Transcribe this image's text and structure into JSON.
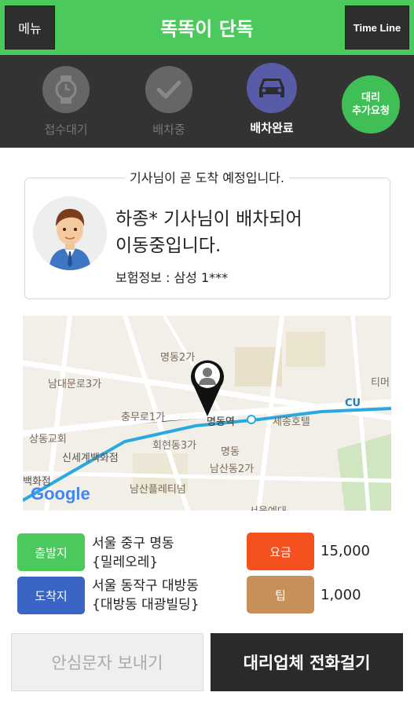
{
  "header": {
    "menu_label": "메뉴",
    "title": "똑똑이 단독",
    "timeline_label": "Time Line"
  },
  "status_steps": [
    {
      "label": "접수대기",
      "icon": "watch-icon"
    },
    {
      "label": "배차중",
      "icon": "check-icon"
    },
    {
      "label": "배차완료",
      "icon": "car-icon"
    }
  ],
  "extra_request": {
    "line1": "대리",
    "line2": "추가요청"
  },
  "notice": "기사님이 곧 도착 예정입니다.",
  "driver": {
    "line1": "하종* 기사님이 배차되어",
    "line2": "이동중입니다.",
    "insurance": "보험정보 : 삼성 1***"
  },
  "map": {
    "labels": [
      "명동2가",
      "남대문로3가",
      "충무로1가",
      "명동역",
      "세종호텔",
      "상동교회",
      "회현동3가",
      "신세계백화점",
      "명동",
      "남산동2가",
      "백화점",
      "남산플레티넘",
      "서울예대",
      "CU",
      "티머"
    ],
    "google_logo": "Google"
  },
  "route": {
    "departure_tag": "출발지",
    "departure_line1": "서울 중구 명동",
    "departure_line2": "{밀레오레}",
    "arrival_tag": "도착지",
    "arrival_line1": "서울 동작구 대방동",
    "arrival_line2": "{대방동 대광빌딩}",
    "fee_tag": "요금",
    "fee_value": "15,000",
    "tip_tag": "팁",
    "tip_value": "1,000"
  },
  "buttons": {
    "safe_message": "안심문자 보내기",
    "call_company": "대리업체 전화걸기"
  },
  "colors": {
    "header_green": "#4cc95c",
    "status_dark": "#333333",
    "active_step": "#585ca8",
    "arrival_blue": "#3a65c4",
    "fee_orange": "#f4511e",
    "tip_brown": "#c69058"
  }
}
